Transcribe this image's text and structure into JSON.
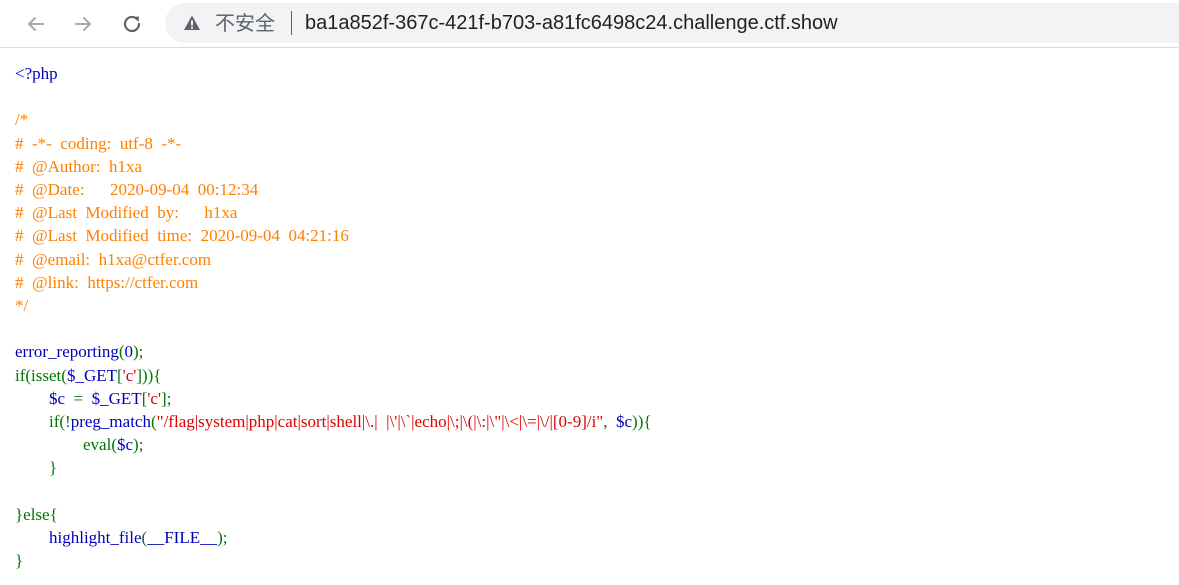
{
  "browser": {
    "insecure_label": "不安全",
    "url": "ba1a852f-367c-421f-b703-a81fc6498c24.challenge.ctf.show"
  },
  "source_lines": [
    [
      {
        "c": "default",
        "t": "<?php"
      }
    ],
    [],
    [
      {
        "c": "comment",
        "t": "/*"
      }
    ],
    [
      {
        "c": "comment",
        "t": "#  -*-  coding:  utf-8  -*-"
      }
    ],
    [
      {
        "c": "comment",
        "t": "#  @Author:  h1xa"
      }
    ],
    [
      {
        "c": "comment",
        "t": "#  @Date:      2020-09-04  00:12:34"
      }
    ],
    [
      {
        "c": "comment",
        "t": "#  @Last  Modified  by:      h1xa"
      }
    ],
    [
      {
        "c": "comment",
        "t": "#  @Last  Modified  time:  2020-09-04  04:21:16"
      }
    ],
    [
      {
        "c": "comment",
        "t": "#  @email:  h1xa@ctfer.com"
      }
    ],
    [
      {
        "c": "comment",
        "t": "#  @link:  https://ctfer.com"
      }
    ],
    [
      {
        "c": "comment",
        "t": "*/"
      }
    ],
    [],
    [
      {
        "c": "default",
        "t": "error_reporting"
      },
      {
        "c": "keyword",
        "t": "("
      },
      {
        "c": "default",
        "t": "0"
      },
      {
        "c": "keyword",
        "t": ");"
      }
    ],
    [
      {
        "c": "keyword",
        "t": "if(isset("
      },
      {
        "c": "default",
        "t": "$_GET"
      },
      {
        "c": "keyword",
        "t": "["
      },
      {
        "c": "string",
        "t": "'c'"
      },
      {
        "c": "keyword",
        "t": "])){"
      }
    ],
    [
      {
        "c": "html",
        "t": "        "
      },
      {
        "c": "default",
        "t": "$c  "
      },
      {
        "c": "keyword",
        "t": "=  "
      },
      {
        "c": "default",
        "t": "$_GET"
      },
      {
        "c": "keyword",
        "t": "["
      },
      {
        "c": "string",
        "t": "'c'"
      },
      {
        "c": "keyword",
        "t": "];"
      }
    ],
    [
      {
        "c": "html",
        "t": "        "
      },
      {
        "c": "keyword",
        "t": "if(!"
      },
      {
        "c": "default",
        "t": "preg_match"
      },
      {
        "c": "keyword",
        "t": "("
      },
      {
        "c": "string",
        "t": "\"/flag|system|php|cat|sort|shell|\\.|  |\\'|\\`|echo|\\;|\\(|\\:|\\\"|\\<|\\=|\\/|[0-9]/i\""
      },
      {
        "c": "keyword",
        "t": ",  "
      },
      {
        "c": "default",
        "t": "$c"
      },
      {
        "c": "keyword",
        "t": ")){"
      }
    ],
    [
      {
        "c": "html",
        "t": "                "
      },
      {
        "c": "keyword",
        "t": "eval("
      },
      {
        "c": "default",
        "t": "$c"
      },
      {
        "c": "keyword",
        "t": ");"
      }
    ],
    [
      {
        "c": "html",
        "t": "        "
      },
      {
        "c": "keyword",
        "t": "}"
      }
    ],
    [],
    [
      {
        "c": "keyword",
        "t": "}else{"
      }
    ],
    [
      {
        "c": "html",
        "t": "        "
      },
      {
        "c": "default",
        "t": "highlight_file"
      },
      {
        "c": "keyword",
        "t": "("
      },
      {
        "c": "default",
        "t": "__FILE__"
      },
      {
        "c": "keyword",
        "t": ");"
      }
    ],
    [
      {
        "c": "keyword",
        "t": "}"
      }
    ]
  ]
}
